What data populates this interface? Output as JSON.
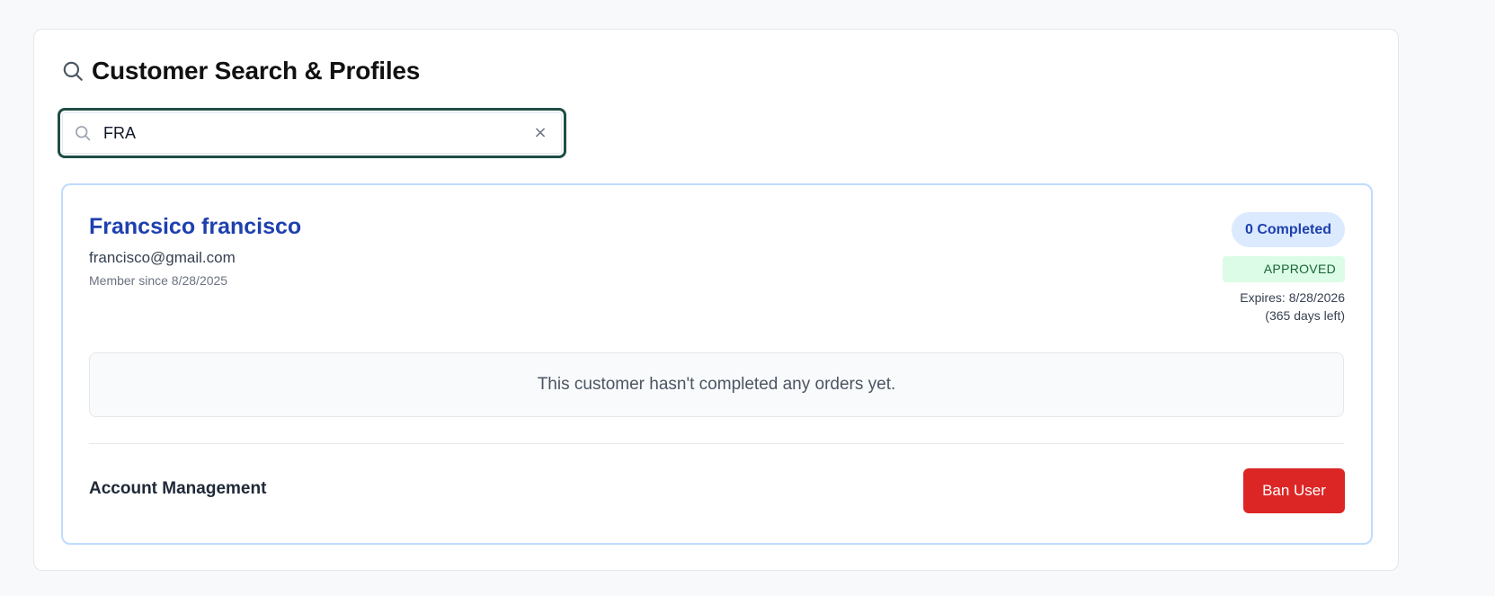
{
  "header": {
    "icon": "search-icon",
    "title": "Customer Search & Profiles"
  },
  "search": {
    "icon": "search-icon",
    "value": "FRA",
    "clear_label": "×"
  },
  "customer": {
    "name": "Francsico francisco",
    "email": "francisco@gmail.com",
    "member_since": "Member since 8/28/2025",
    "completed_badge": "0 Completed",
    "status": "APPROVED",
    "expires": "Expires: 8/28/2026",
    "days_left": "(365 days left)",
    "orders_empty_message": "This customer hasn't completed any orders yet."
  },
  "account_management": {
    "title": "Account Management",
    "ban_label": "Ban User"
  },
  "colors": {
    "accent_blue": "#1e40af",
    "approved_green": "#166534",
    "danger_red": "#dc2626",
    "search_border": "#1f4e46"
  }
}
